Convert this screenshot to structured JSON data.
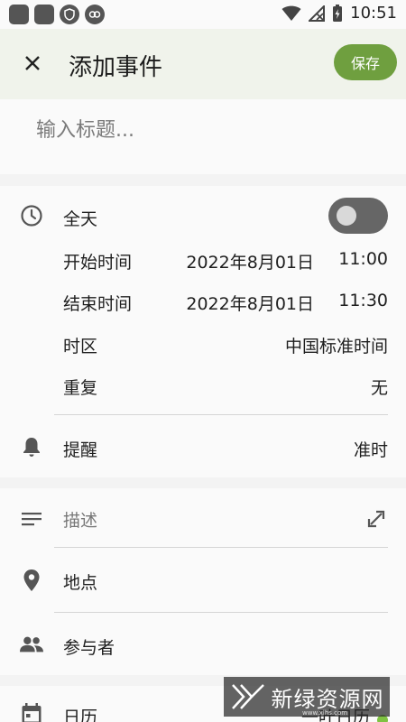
{
  "status_bar": {
    "time": "10:51"
  },
  "header": {
    "title": "添加事件",
    "save_label": "保存"
  },
  "title_field": {
    "placeholder": "输入标题..."
  },
  "time_section": {
    "all_day_label": "全天",
    "all_day_enabled": false,
    "start_label": "开始时间",
    "start_date": "2022年8月01日",
    "start_time": "11:00",
    "end_label": "结束时间",
    "end_date": "2022年8月01日",
    "end_time": "11:30",
    "timezone_label": "时区",
    "timezone_value": "中国标准时间",
    "repeat_label": "重复",
    "repeat_value": "无",
    "reminder_label": "提醒",
    "reminder_value": "准时"
  },
  "details_section": {
    "description_placeholder": "描述",
    "location_label": "地点",
    "attendees_label": "参与者"
  },
  "calendar_section": {
    "label": "日历",
    "value": "一叶日历",
    "color": "#7fc242"
  },
  "watermark": {
    "text": "新绿资源网",
    "url": "www.xlhs.com"
  },
  "colors": {
    "accent": "#6f9f3f",
    "appbar": "#f0f3eb"
  }
}
